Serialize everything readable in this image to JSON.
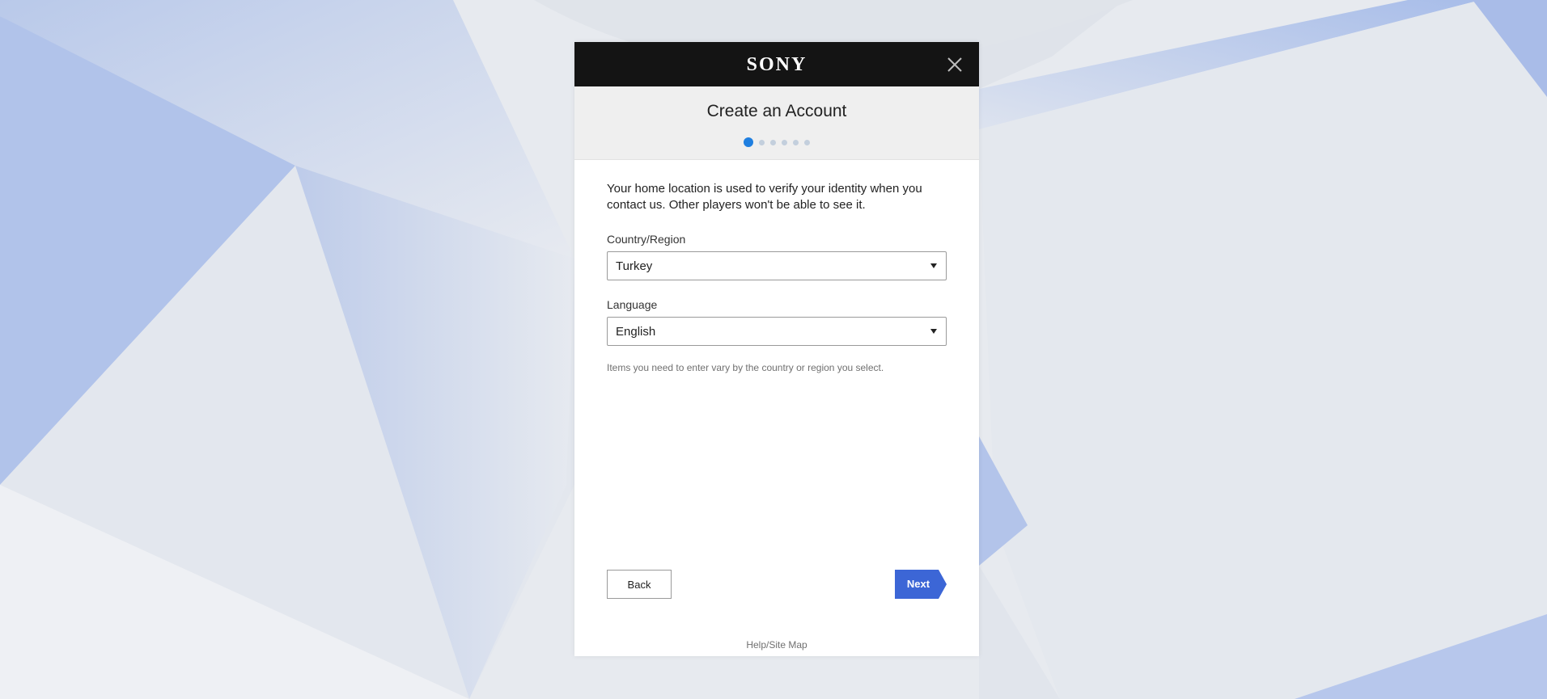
{
  "brand": {
    "logo_text": "SONY"
  },
  "header": {
    "title": "Create an Account",
    "progress": {
      "current_step": 1,
      "total_steps": 6
    }
  },
  "content": {
    "intro": "Your home location is used to verify your identity when you contact us. Other players won't be able to see it.",
    "country": {
      "label": "Country/Region",
      "value": "Turkey"
    },
    "language": {
      "label": "Language",
      "value": "English"
    },
    "note": "Items you need to enter vary by the country or region you select."
  },
  "buttons": {
    "back_label": "Back",
    "next_label": "Next"
  },
  "footer": {
    "help_link": "Help/Site Map"
  },
  "colors": {
    "brand_bar": "#141414",
    "accent": "#1f7fe0",
    "next_button": "#3c66d6"
  },
  "icons": {
    "close": "close-icon",
    "dropdown": "caret-down-icon"
  }
}
